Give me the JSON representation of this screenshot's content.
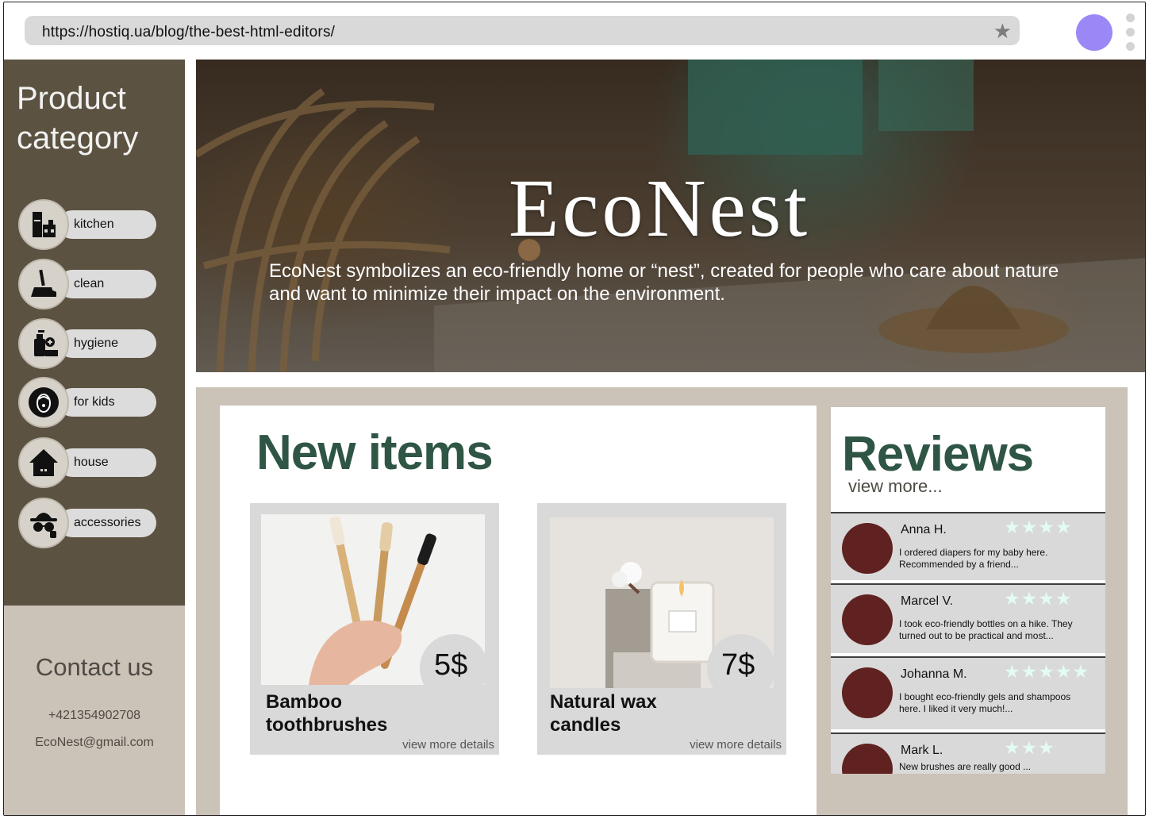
{
  "browser": {
    "url": "https://hostiq.ua/blog/the-best-html-editors/",
    "bookmark_icon": "star-icon",
    "avatar_color": "#9b87f5",
    "menu_icon": "kebab-menu-icon"
  },
  "sidebar": {
    "title": "Product category",
    "background": "#5c5241",
    "categories": [
      {
        "label": "kitchen",
        "icon": "kitchen-icon"
      },
      {
        "label": "clean",
        "icon": "broom-icon"
      },
      {
        "label": "hygiene",
        "icon": "soap-icon"
      },
      {
        "label": "for kids",
        "icon": "baby-icon"
      },
      {
        "label": "house",
        "icon": "house-icon"
      },
      {
        "label": "accessories",
        "icon": "hat-glasses-icon"
      }
    ]
  },
  "contact": {
    "title": "Contact us",
    "phone": "+421354902708",
    "email": "EcoNest@gmail.com"
  },
  "hero": {
    "brand": "EcoNest",
    "tagline": "EcoNest symbolizes an eco-friendly home or “nest”, created for people who care about nature and want to minimize their impact on the environment."
  },
  "new_items": {
    "heading": "New items",
    "accent_color": "#2f5545",
    "items": [
      {
        "name": "Bamboo toothbrushes",
        "price": "5$",
        "link": "view more details"
      },
      {
        "name": "Natural wax candles",
        "price": "7$",
        "link": "view more details"
      }
    ]
  },
  "reviews": {
    "heading": "Reviews",
    "view_more": "view more...",
    "items": [
      {
        "name": "Anna H.",
        "rating": 4,
        "stars": "★★★★",
        "text": "I ordered diapers for my baby here. Recommended by a friend..."
      },
      {
        "name": "Marcel V.",
        "rating": 4,
        "stars": "★★★★",
        "text": "I took eco-friendly bottles on a hike. They turned out to be practical and most..."
      },
      {
        "name": "Johanna M.",
        "rating": 5,
        "stars": "★★★★★",
        "text": "I bought eco-friendly gels and shampoos here. I liked it very much!..."
      },
      {
        "name": "Mark L.",
        "rating": 3,
        "stars": "★★★",
        "text": "New brushes are really good ..."
      }
    ]
  }
}
